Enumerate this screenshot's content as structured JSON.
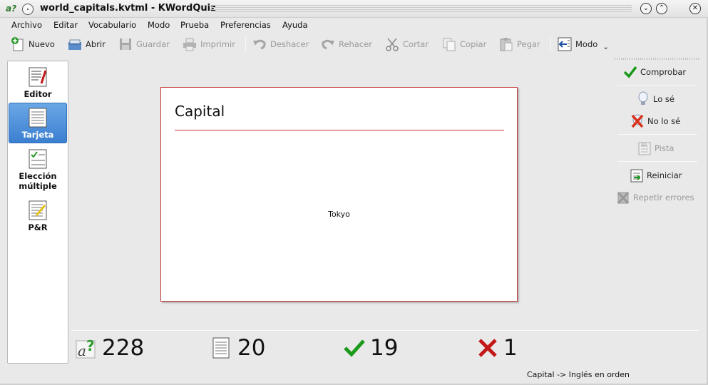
{
  "window": {
    "title": "world_capitals.kvtml - KWordQuiz",
    "app_icon": "kwordquiz-icon"
  },
  "menu": [
    "Archivo",
    "Editar",
    "Vocabulario",
    "Modo",
    "Prueba",
    "Preferencias",
    "Ayuda"
  ],
  "toolbar": {
    "nuevo": "Nuevo",
    "abrir": "Abrir",
    "guardar": "Guardar",
    "imprimir": "Imprimir",
    "deshacer": "Deshacer",
    "rehacer": "Rehacer",
    "cortar": "Cortar",
    "copiar": "Copiar",
    "pegar": "Pegar",
    "modo": "Modo"
  },
  "modes": {
    "editor": "Editor",
    "tarjeta": "Tarjeta",
    "eleccion_line1": "Elección",
    "eleccion_line2": "múltiple",
    "pyr": "P&R",
    "active": "Tarjeta"
  },
  "card": {
    "title": "Capital",
    "word": "Tokyo"
  },
  "actions": {
    "comprobar": "Comprobar",
    "lo_se": "Lo sé",
    "no_lo_se": "No lo sé",
    "pista": "Pista",
    "reiniciar": "Reiniciar",
    "repetir_errores": "Repetir errores"
  },
  "scores": {
    "total": "228",
    "questions": "20",
    "correct": "19",
    "errors": "1"
  },
  "status": {
    "direction": "Capital -> Inglés en orden"
  },
  "colors": {
    "accent": "#3b7fd0",
    "card_border": "#c43a3a",
    "correct": "#1a9a1a",
    "error": "#c41818"
  }
}
